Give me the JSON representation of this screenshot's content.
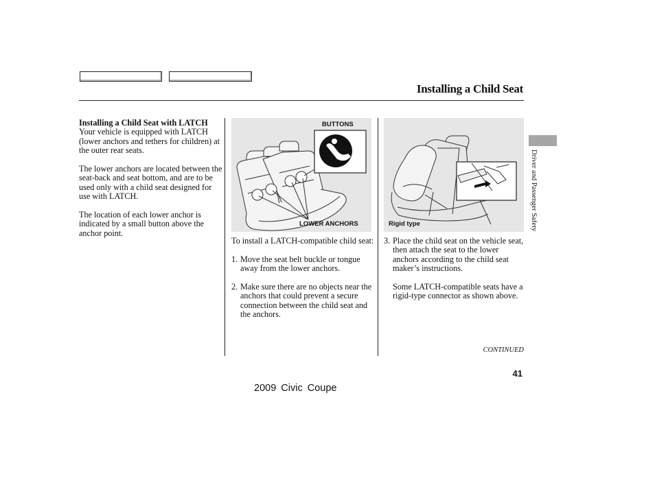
{
  "nav": {
    "buttons": [
      {
        "label": ""
      },
      {
        "label": ""
      }
    ]
  },
  "header": {
    "title": "Installing a Child Seat"
  },
  "column1": {
    "heading": "Installing a Child Seat with LATCH",
    "paragraphs": [
      "Your vehicle is equipped with LATCH (lower anchors and tethers for children) at the outer rear seats.",
      "The lower anchors are located between the seat-back and seat bottom, and are to be used only with a child seat designed for use with LATCH.",
      "The location of each lower anchor is indicated by a small button above the anchor point."
    ]
  },
  "figure1": {
    "label_top": "BUTTONS",
    "label_bottom": "LOWER ANCHORS",
    "icon": "child-seat-anchor-symbol-icon"
  },
  "figure2": {
    "caption": "Rigid type"
  },
  "column2": {
    "intro": "To install a LATCH-compatible child seat:",
    "steps": [
      {
        "num": "1.",
        "text": "Move the seat belt buckle or tongue away from the lower anchors."
      },
      {
        "num": "2.",
        "text": "Make sure there are no objects near the anchors that could prevent a secure connection between the child seat and the anchors."
      }
    ]
  },
  "column3": {
    "steps": [
      {
        "num": "3.",
        "text": "Place the child seat on the vehicle seat, then attach the seat to the lower anchors according to the child seat maker’s instructions."
      }
    ],
    "note": "Some LATCH-compatible seats have a rigid-type connector as shown above."
  },
  "footer": {
    "continued": "CONTINUED",
    "page_number": "41",
    "model": "2009  Civic  Coupe"
  },
  "side_tab": {
    "section": "Driver and Passenger Safety",
    "color": "#a6a6a6"
  }
}
